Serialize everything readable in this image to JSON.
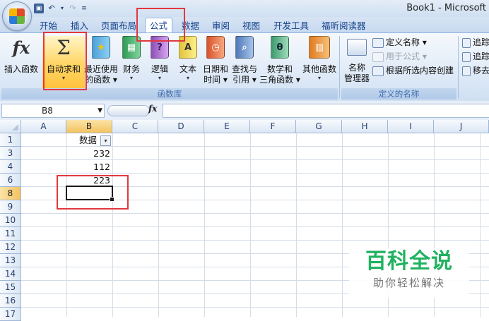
{
  "window": {
    "title": "Book1 - Microsoft"
  },
  "tabs": [
    "开始",
    "插入",
    "页面布局",
    "公式",
    "数据",
    "审阅",
    "视图",
    "开发工具",
    "福昕阅读器"
  ],
  "active_tab": "公式",
  "ribbon": {
    "function_library": {
      "label": "函数库",
      "buttons": [
        {
          "line1": "插入函数",
          "line2": "",
          "icon": "fx-icon"
        },
        {
          "line1": "自动求和",
          "line2": "▾",
          "icon": "sigma-icon"
        },
        {
          "line1": "最近使用",
          "line2": "的函数 ▾",
          "icon": "star-book-icon"
        },
        {
          "line1": "财务",
          "line2": "▾",
          "icon": "finance-book-icon"
        },
        {
          "line1": "逻辑",
          "line2": "▾",
          "icon": "question-book-icon"
        },
        {
          "line1": "文本",
          "line2": "▾",
          "icon": "text-book-icon"
        },
        {
          "line1": "日期和",
          "line2": "时间 ▾",
          "icon": "clock-book-icon"
        },
        {
          "line1": "查找与",
          "line2": "引用 ▾",
          "icon": "magnifier-book-icon"
        },
        {
          "line1": "数学和",
          "line2": "三角函数 ▾",
          "icon": "theta-book-icon"
        },
        {
          "line1": "其他函数",
          "line2": "▾",
          "icon": "more-books-icon"
        }
      ]
    },
    "defined_names": {
      "label": "定义的名称",
      "manager_line1": "名称",
      "manager_line2": "管理器",
      "define_name": "定义名称 ▾",
      "use_in_formula": "用于公式 ▾",
      "create_from_selection": "根据所选内容创建"
    },
    "auditing": {
      "trace1": "追踪",
      "trace2": "追踪",
      "remove": "移去"
    }
  },
  "formula_bar": {
    "name_box": "B8",
    "fx": "fx",
    "value": ""
  },
  "grid": {
    "columns": [
      "A",
      "B",
      "C",
      "D",
      "E",
      "F",
      "G",
      "H",
      "I",
      "J"
    ],
    "rows": [
      "1",
      "3",
      "4",
      "6",
      "8",
      "9",
      "10",
      "11",
      "12",
      "13",
      "14",
      "15",
      "16",
      "17"
    ],
    "header_cell": "数据",
    "values": [
      "232",
      "112",
      "223"
    ],
    "selected_column": "B",
    "selected_row": "8",
    "filter_glyph": "▾"
  },
  "watermark": {
    "line1": "百科全说",
    "line2": "助你轻松解决"
  },
  "colors": {
    "annotation": "#e2373f",
    "watermark_green": "#1fb25f"
  }
}
